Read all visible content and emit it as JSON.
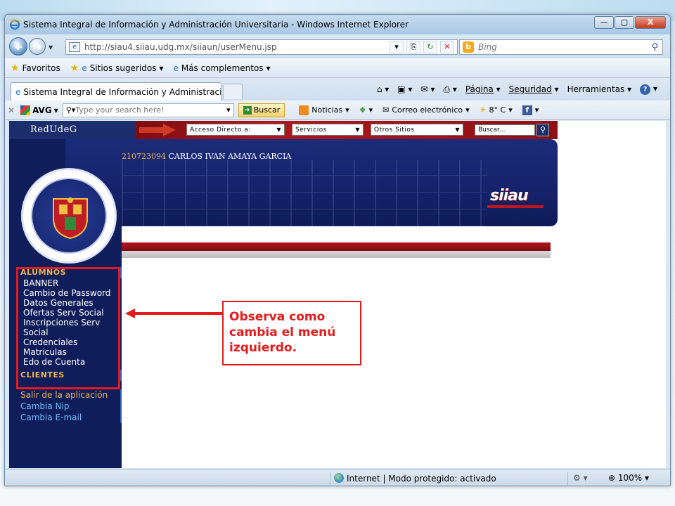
{
  "window": {
    "title": "Sistema Integral de Información y Administración Universitaria - Windows Internet Explorer",
    "minimize": "—",
    "maximize": "▢",
    "close": "X"
  },
  "address": {
    "url": "http://siau4.siiau.udg.mx/siiaun/userMenu.jsp",
    "search_placeholder": "Bing"
  },
  "favorites": {
    "favoritos": "Favoritos",
    "sitios": "Sitios sugeridos",
    "complementos": "Más complementos"
  },
  "tabs": [
    {
      "label": "Sistema Integral de Información y Administració..."
    }
  ],
  "command_bar": {
    "pagina": "Página",
    "seguridad": "Seguridad",
    "herramientas": "Herramientas"
  },
  "avg": {
    "brand": "AVG",
    "search_placeholder": "Type your search here!",
    "buscar": "Buscar",
    "noticias": "Noticias",
    "correo": "Correo electrónico",
    "weather": "8° C"
  },
  "site": {
    "brand": "RedUdeG",
    "acceso": "Acceso Directo a:",
    "servicios": "Servicios",
    "otros": "Otros Sitios",
    "buscar": "Buscar...",
    "student_id": "210723094",
    "student_name": "CARLOS IVAN AMAYA GARCIA",
    "siiau_logo": "siiau"
  },
  "menu": {
    "alumnos_head": "ALUMNOS",
    "items": [
      "BANNER",
      "Cambio de Password",
      "Datos Generales",
      "Ofertas Serv Social",
      "Inscripciones Serv",
      "Social",
      "Credenciales",
      "Matriculas",
      "Edo de Cuenta"
    ],
    "clientes_head": "CLIENTES",
    "salir": "Salir de la aplicación",
    "cambia_nip": "Cambia Nip",
    "cambia_email": "Cambia E-mail"
  },
  "callout": {
    "text": "Observa como cambia el menú izquierdo."
  },
  "status": {
    "zone": "Internet | Modo protegido: activado",
    "zoom": "100%"
  },
  "colors": {
    "callout_red": "#e31b1b",
    "site_navy": "#0f1e5b",
    "site_red": "#b0161c",
    "menu_gold": "#f0b24a",
    "menu_link": "#6fb8ff"
  }
}
